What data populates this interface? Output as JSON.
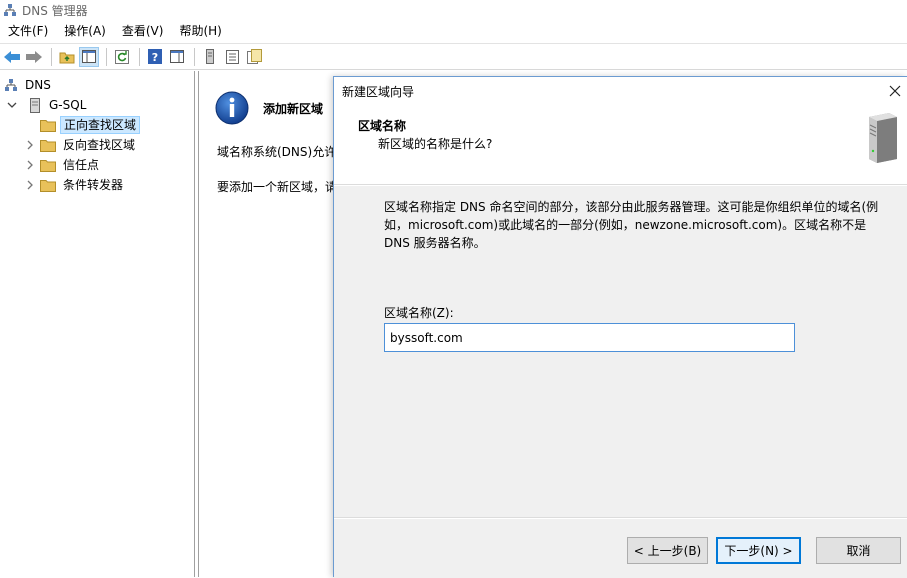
{
  "window": {
    "title": "DNS 管理器"
  },
  "menu": [
    "文件(F)",
    "操作(A)",
    "查看(V)",
    "帮助(H)"
  ],
  "tree": {
    "root": "DNS",
    "server": "G-SQL",
    "items": [
      "正向查找区域",
      "反向查找区域",
      "信任点",
      "条件转发器"
    ]
  },
  "middle": {
    "title": "添加新区域",
    "line1": "域名称系统(DNS)允许",
    "line2": "要添加一个新区域，请"
  },
  "wizard": {
    "title": "新建区域向导",
    "heading": "区域名称",
    "subheading": "新区域的名称是什么?",
    "description": "区域名称指定 DNS 命名空间的部分，该部分由此服务器管理。这可能是你组织单位的域名(例如，microsoft.com)或此域名的一部分(例如，newzone.microsoft.com)。区域名称不是 DNS 服务器名称。",
    "field_label": "区域名称(Z):",
    "field_value": "byssoft.com",
    "back_label": "< 上一步(B)",
    "next_label": "下一步(N) >",
    "cancel_label": "取消"
  },
  "colors": {
    "accent": "#0078d7",
    "folder": "#e8c15a",
    "selection": "#cce8ff"
  }
}
